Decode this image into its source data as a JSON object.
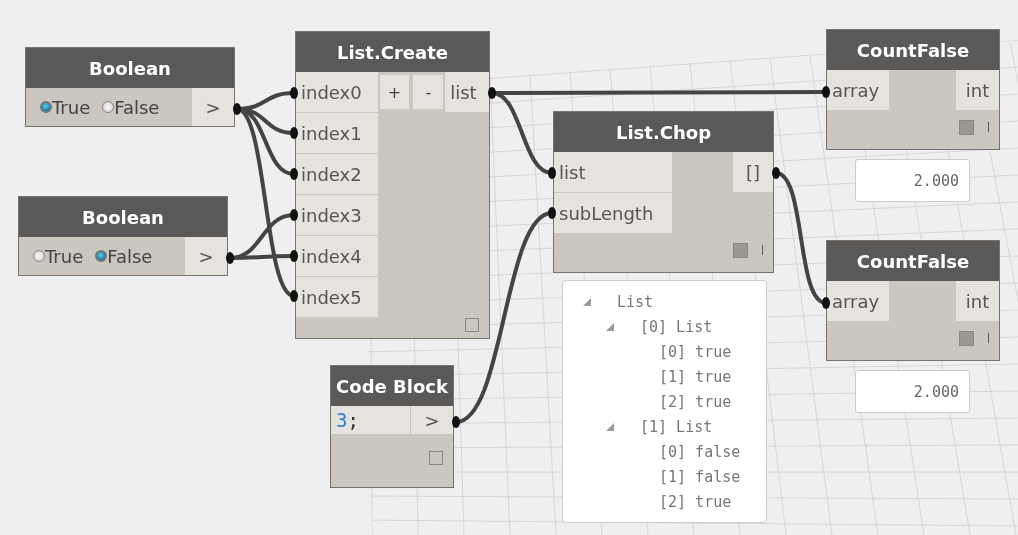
{
  "nodes": [
    {
      "kind": "boolean",
      "title": "Boolean",
      "options": [
        {
          "label": "True",
          "selected": true
        },
        {
          "label": "False",
          "selected": false
        }
      ],
      "outputs": [
        ">"
      ]
    },
    {
      "kind": "boolean",
      "title": "Boolean",
      "options": [
        {
          "label": "True",
          "selected": false
        },
        {
          "label": "False",
          "selected": true
        }
      ],
      "outputs": [
        ">"
      ]
    },
    {
      "kind": "list_create",
      "title": "List.Create",
      "inputs": [
        "index0",
        "index1",
        "index2",
        "index3",
        "index4",
        "index5"
      ],
      "add_button": "+",
      "remove_button": "-",
      "outputs": [
        "list"
      ]
    },
    {
      "kind": "function",
      "title": "List.Chop",
      "inputs": [
        "list",
        "subLength"
      ],
      "outputs": [
        "[]"
      ]
    },
    {
      "kind": "function",
      "title": "CountFalse",
      "inputs": [
        "array"
      ],
      "outputs": [
        "int"
      ],
      "preview": "2.000"
    },
    {
      "kind": "function",
      "title": "CountFalse",
      "inputs": [
        "array"
      ],
      "outputs": [
        "int"
      ],
      "preview": "2.000"
    },
    {
      "kind": "code_block",
      "title": "Code Block",
      "code": "3;",
      "outputs": [
        ">"
      ]
    }
  ],
  "watch": {
    "label": "List",
    "expanded": true,
    "children": [
      {
        "label": "[0] List",
        "expanded": true,
        "children": [
          {
            "label": "[0] true"
          },
          {
            "label": "[1] true"
          },
          {
            "label": "[2] true"
          }
        ]
      },
      {
        "label": "[1] List",
        "expanded": true,
        "children": [
          {
            "label": "[0] false"
          },
          {
            "label": "[1] false"
          },
          {
            "label": "[2] true"
          }
        ]
      }
    ]
  }
}
